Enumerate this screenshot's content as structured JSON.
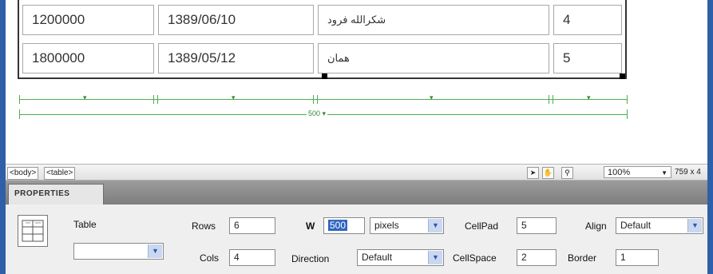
{
  "table_rows": [
    {
      "amount": "1200000",
      "date": "1389/06/10",
      "name": "شکرالله فرود",
      "index": "4"
    },
    {
      "amount": "1800000",
      "date": "1389/05/12",
      "name": "همان",
      "index": "5"
    }
  ],
  "width_guide": {
    "label": "500 ▾"
  },
  "status_bar": {
    "tags": [
      "<body>",
      "<table>"
    ],
    "zoom": "100%",
    "dimensions": "759 x 4"
  },
  "properties": {
    "title": "PROPERTIES",
    "element_type": "Table",
    "table_id_value": "",
    "rows_label": "Rows",
    "rows_value": "6",
    "cols_label": "Cols",
    "cols_value": "4",
    "w_label": "W",
    "w_value": "500",
    "units_value": "pixels",
    "direction_label": "Direction",
    "direction_value": "Default",
    "cellpad_label": "CellPad",
    "cellpad_value": "5",
    "cellspace_label": "CellSpace",
    "cellspace_value": "2",
    "align_label": "Align",
    "align_value": "Default",
    "border_label": "Border",
    "border_value": "1"
  },
  "colors": {
    "accent_blue": "#2f5fa7",
    "guide_green": "#4caf50",
    "selection": "#3166c4"
  }
}
